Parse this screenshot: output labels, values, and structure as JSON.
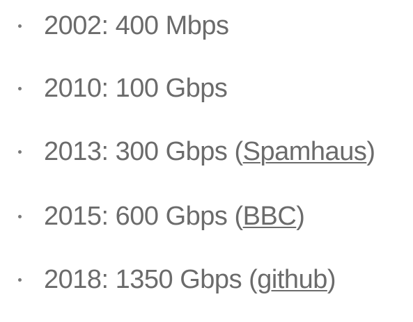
{
  "items": [
    {
      "text": "2002: 400 Mbps",
      "link": "",
      "open": "",
      "close": ""
    },
    {
      "text": "2010: 100 Gbps",
      "link": "",
      "open": "",
      "close": ""
    },
    {
      "text": "2013: 300 Gbps ",
      "link": "Spamhaus",
      "open": "(",
      "close": ")"
    },
    {
      "text": "2015: 600 Gbps ",
      "link": "BBC",
      "open": "(",
      "close": ")"
    },
    {
      "text": "2018: 1350 Gbps ",
      "link": "github",
      "open": "(",
      "close": ")"
    }
  ]
}
